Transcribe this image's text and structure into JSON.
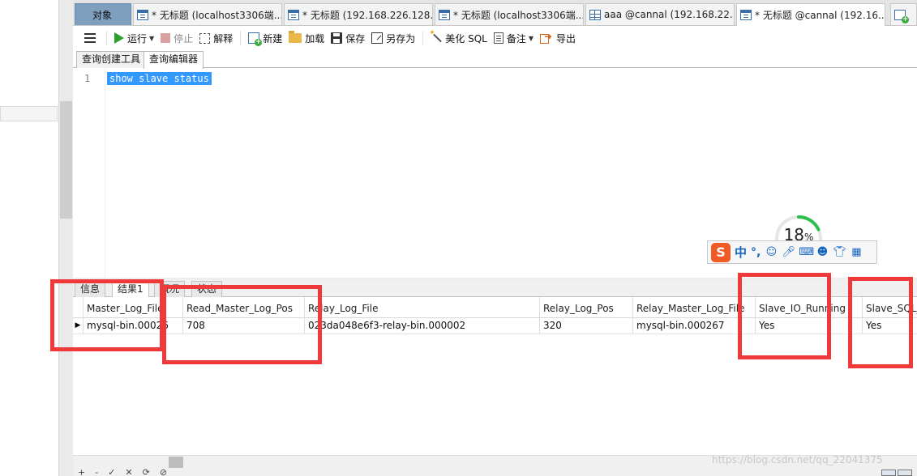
{
  "tabs": [
    {
      "label": "对象",
      "kind": "objects"
    },
    {
      "label": "* 无标题 (localhost3306端...",
      "kind": "query"
    },
    {
      "label": "* 无标题 (192.168.226.128...",
      "kind": "query"
    },
    {
      "label": "* 无标题 (localhost3306端...",
      "kind": "query"
    },
    {
      "label": "aaa @cannal (192.168.22...",
      "kind": "table"
    },
    {
      "label": "* 无标题 @cannal (192.16...",
      "kind": "query",
      "active": true
    }
  ],
  "toolbar": {
    "run": "运行",
    "stop": "停止",
    "explain": "解释",
    "new": "新建",
    "load": "加载",
    "save": "保存",
    "save_as": "另存为",
    "beautify": "美化 SQL",
    "note": "备注",
    "export": "导出"
  },
  "subtabs": [
    "查询创建工具",
    "查询编辑器"
  ],
  "editor": {
    "line_number": "1",
    "sql": "show slave status"
  },
  "result_tabs": [
    "信息",
    "结果1",
    "概况",
    "状态"
  ],
  "result_grid": {
    "columns": [
      "Master_Log_File",
      "Read_Master_Log_Pos",
      "Relay_Log_File",
      "Relay_Log_Pos",
      "Relay_Master_Log_File",
      "Slave_IO_Running",
      "Slave_SQL_"
    ],
    "rows": [
      [
        "mysql-bin.00026",
        "708",
        "023da048e6f3-relay-bin.000002",
        "320",
        "mysql-bin.000267",
        "Yes",
        "Yes"
      ]
    ]
  },
  "ime": {
    "logo": "S",
    "mode": "中",
    "punctuation": "°,"
  },
  "gauge": {
    "value": "18",
    "unit": "%",
    "fraction": 0.18,
    "color": "#2bc04a"
  },
  "watermark": "https://blog.csdn.net/qq_22041375",
  "highlight_color": "#f03a3a",
  "icons": {
    "menu": "menu-icon",
    "run": "play-icon",
    "stop": "stop-icon",
    "explain": "explain-icon",
    "new": "new-query-icon",
    "load": "folder-icon",
    "save": "save-icon",
    "save_as": "save-as-icon",
    "beautify": "magic-wand-icon",
    "note": "note-icon",
    "export": "export-icon"
  }
}
